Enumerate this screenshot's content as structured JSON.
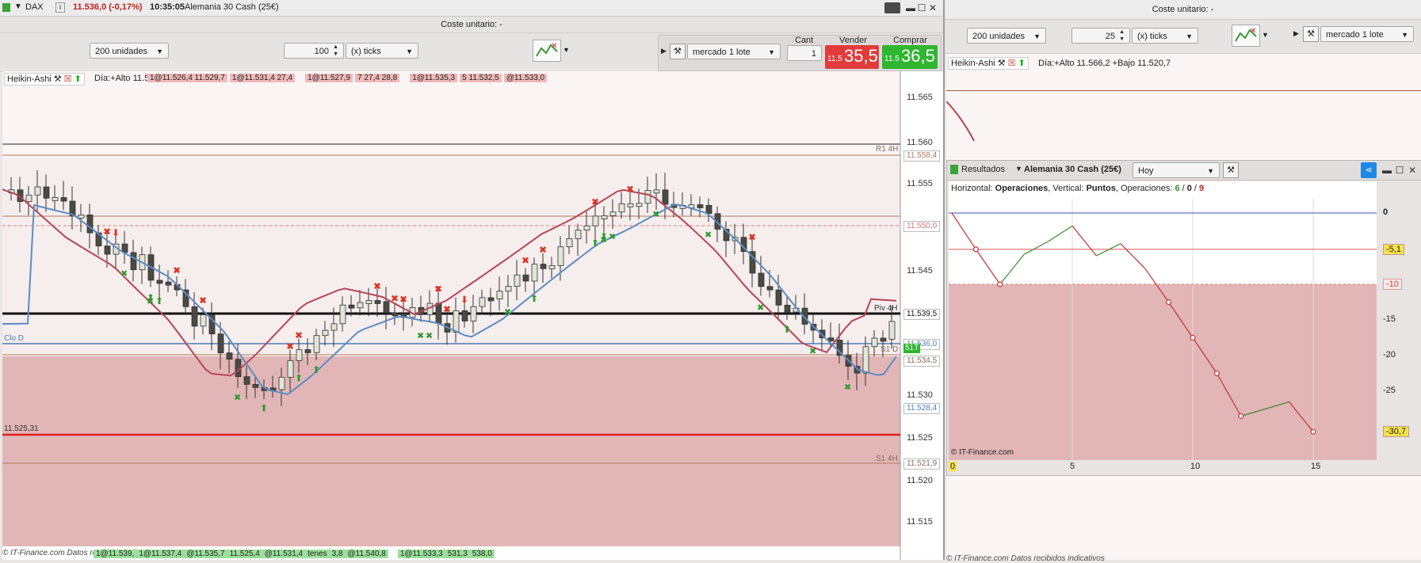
{
  "left": {
    "symbol": "DAX",
    "quote": "11.536,0 (-0,17%)",
    "time": "10:35:05",
    "instrument": "Alemania 30 Cash (25€)",
    "cost_label": "Coste unitario: -",
    "units_label": "200 unidades",
    "ticks_value": "100",
    "ticks_label": "(x) ticks",
    "order_type": "mercado 1 lote",
    "cant_label": "Cant",
    "cant_value": "1",
    "sell_label": "Vender",
    "buy_label": "Comprar",
    "sell_price_small": "11.5",
    "sell_price_big": "35,5",
    "buy_price_small": "11.5",
    "buy_price_big": "36,5",
    "indicator": "Heikin-Ashi",
    "day_info": "Día:+Alto 11.56",
    "order_tags_row1": [
      "1@11.526,4 11.529,7",
      "1@11.531,4 27,4",
      "1@11.527,9",
      "7 27,4 28,8",
      "1@11.535,3",
      "5 11.532,5",
      "@11.533,0"
    ],
    "price_ticks": [
      "11.565",
      "11.560",
      "11.555",
      "11.550",
      "11.545",
      "11.540",
      "11.535",
      "11.530",
      "11.525",
      "11.520",
      "11.515"
    ],
    "level_labels": {
      "r1": "R1 4H",
      "r1_price": "11.558,4",
      "dash_price": "11.550,0",
      "piv": "Piv 4H",
      "piv_price": "11.539,5",
      "clo": "Clo D",
      "clo_price": "11.536,0",
      "s1d": "S1 D",
      "s1d_price": "11.534,5",
      "s1t": "51T",
      "blue_price": "11.528,4",
      "red_left": "11.525,31",
      "s1_4h": "S1 4H",
      "s1_price": "11.521,9"
    },
    "footer_text": "© IT-Finance.com Datos recibidos indicativos",
    "footer_tags": [
      "1@11.539,",
      "1@11.537,4",
      "@11.535,7",
      "11.525,4",
      "@11.531,4",
      "tenes",
      "3,8",
      "@11.540,8",
      "1@11.533,3",
      "531,3",
      "538,0"
    ]
  },
  "right": {
    "cost_label": "Coste unitario: -",
    "units_label": "200 unidades",
    "ticks_value": "25",
    "ticks_label": "(x) ticks",
    "order_type": "mercado 1 lote",
    "indicator": "Heikin-Ashi",
    "day_info": "Día:+Alto 11.566,2 +Bajo 11.520,7",
    "footer_text": "© IT-Finance.com Datos recibidos indicativos"
  },
  "results": {
    "tab": "Resultados",
    "instrument": "Alemania 30 Cash (25€)",
    "period": "Hoy",
    "info_prefix": "Horizontal: ",
    "info_h": "Operaciones",
    "info_mid": ", Vertical: ",
    "info_v": "Puntos",
    "info_ops": ", Operaciones: ",
    "ops_green": "6",
    "ops_sep1": " / ",
    "ops_black": "0",
    "ops_sep2": " / ",
    "ops_red": "9",
    "watermark": "© IT-Finance.com",
    "y_ticks": [
      "0",
      "-5,1",
      "-10",
      "-15",
      "-20",
      "-25",
      "-30,7"
    ],
    "x_ticks": [
      "0",
      "5",
      "10",
      "15"
    ]
  },
  "chart_data": {
    "type": "line",
    "title": "",
    "xlabel": "Operaciones",
    "ylabel": "Puntos",
    "xlim": [
      0,
      17.5
    ],
    "ylim": [
      -34,
      2
    ],
    "series": [
      {
        "name": "",
        "x": [
          0,
          1,
          2,
          3,
          4,
          5,
          6,
          7,
          8,
          9,
          10,
          11,
          12,
          13,
          14,
          15
        ],
        "y": [
          0,
          -5.1,
          -10,
          -5.8,
          -4,
          -1.8,
          -6,
          -4.3,
          -7.7,
          -12.5,
          -17.5,
          -22.5,
          -28.5,
          -27.5,
          -26.5,
          -30.7
        ]
      }
    ],
    "reference_lines": [
      0,
      -5.1,
      -10
    ],
    "grid": true,
    "legend": "none"
  },
  "colors": {
    "sell": "#e23b3b",
    "buy": "#2fb52f",
    "loss_zone": "#e2b6b6",
    "profit_line": "#3a8a2a",
    "loss_line": "#c43232"
  }
}
